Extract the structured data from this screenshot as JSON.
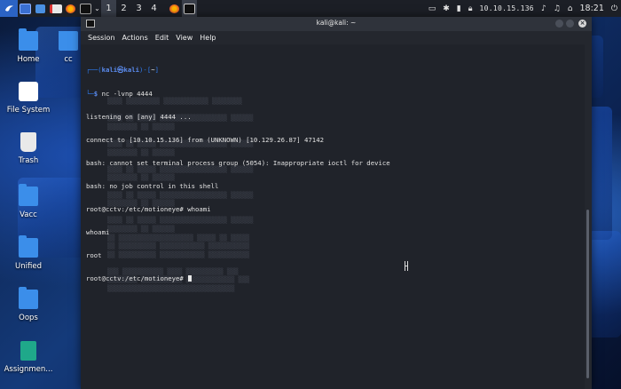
{
  "panel": {
    "workspaces": [
      "1",
      "2",
      "3",
      "4"
    ],
    "active_workspace": "1",
    "ip": "10.10.15.136",
    "clock": "18:21"
  },
  "desktop": {
    "icons": [
      {
        "label": "Home",
        "icon": "home-folder-icon"
      },
      {
        "label": "File System",
        "icon": "drive-icon"
      },
      {
        "label": "Trash",
        "icon": "trash-icon"
      },
      {
        "label": "Vacc",
        "icon": "folder-icon"
      },
      {
        "label": "Unified",
        "icon": "folder-icon"
      },
      {
        "label": "Oops",
        "icon": "folder-icon"
      },
      {
        "label": "Assignmen...",
        "icon": "archive-icon"
      }
    ],
    "partial_icon_label": "cc"
  },
  "terminal": {
    "title": "kali@kali: ~",
    "menu": [
      "Session",
      "Actions",
      "Edit",
      "View",
      "Help"
    ],
    "prompt": {
      "open": "┌──(",
      "user": "kali",
      "at": "㉿",
      "host": "kali",
      "mid": ")-[",
      "path": "~",
      "close": "]",
      "second": "└─",
      "symbol": "$",
      "command": " nc -lvnp 4444"
    },
    "output": [
      "listening on [any] 4444 ...",
      "connect to [10.10.15.136] from (UNKNOWN) [10.129.26.87] 47142",
      "bash: cannot set terminal process group (5054): Inappropriate ioctl for device",
      "bash: no job control in this shell",
      "root@cctv:/etc/motioneye# whoami",
      "whoami",
      "root"
    ],
    "current_prompt": "root@cctv:/etc/motioneye# "
  },
  "colors": {
    "panel_bg": "#1c1f26",
    "kali_blue": "#2b63c4",
    "terminal_bg": "#20232a",
    "prompt_blue": "#2f7df4",
    "folder_blue": "#3b8eea"
  }
}
